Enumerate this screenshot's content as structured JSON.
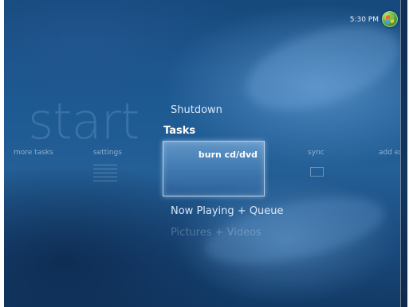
{
  "status": {
    "time": "5:30 PM",
    "orb_icon": "windows-orb-icon"
  },
  "background_word": "start",
  "menu": {
    "shutdown": "Shutdown",
    "section_label": "Tasks",
    "now_playing": "Now Playing + Queue",
    "pictures_videos": "Pictures + Videos"
  },
  "strip": {
    "items": [
      "more tasks",
      "settings",
      "sync",
      "add ext"
    ],
    "selected": "burn cd/dvd"
  },
  "icons": {
    "settings": "settings-lines-icon",
    "sync": "sync-device-icon"
  },
  "colors": {
    "background": "#1d5a92",
    "tile_highlight": "#8fc0ee",
    "orb_green": "#5fb33a"
  }
}
